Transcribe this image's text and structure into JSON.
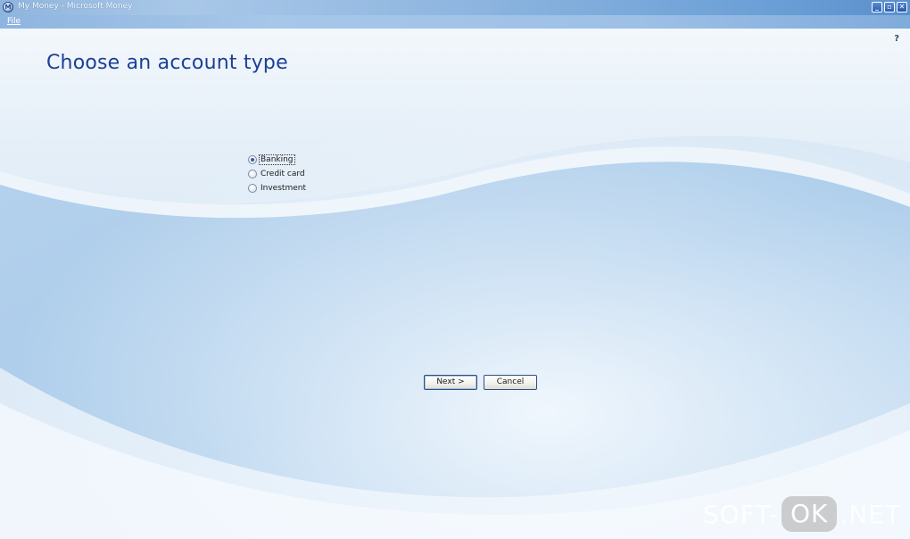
{
  "window": {
    "title": "My Money - Microsoft Money",
    "icon": "money-app-icon",
    "controls": {
      "minimize": "_",
      "restore": "▫",
      "close": "✕"
    }
  },
  "menubar": {
    "items": [
      {
        "label": "File"
      }
    ]
  },
  "help": {
    "label": "?"
  },
  "page": {
    "title": "Choose an account type"
  },
  "account_types": {
    "options": [
      {
        "label": "Banking",
        "selected": true
      },
      {
        "label": "Credit card",
        "selected": false
      },
      {
        "label": "Investment",
        "selected": false
      }
    ]
  },
  "actions": {
    "next_label": "Next >",
    "cancel_label": "Cancel"
  },
  "watermark": {
    "left": "SOFT-",
    "middle": "OK",
    "right": ".NET"
  },
  "colors": {
    "title_text": "#1b3f95",
    "titlebar": "#8fb4dc",
    "background": "#dceaf6"
  }
}
